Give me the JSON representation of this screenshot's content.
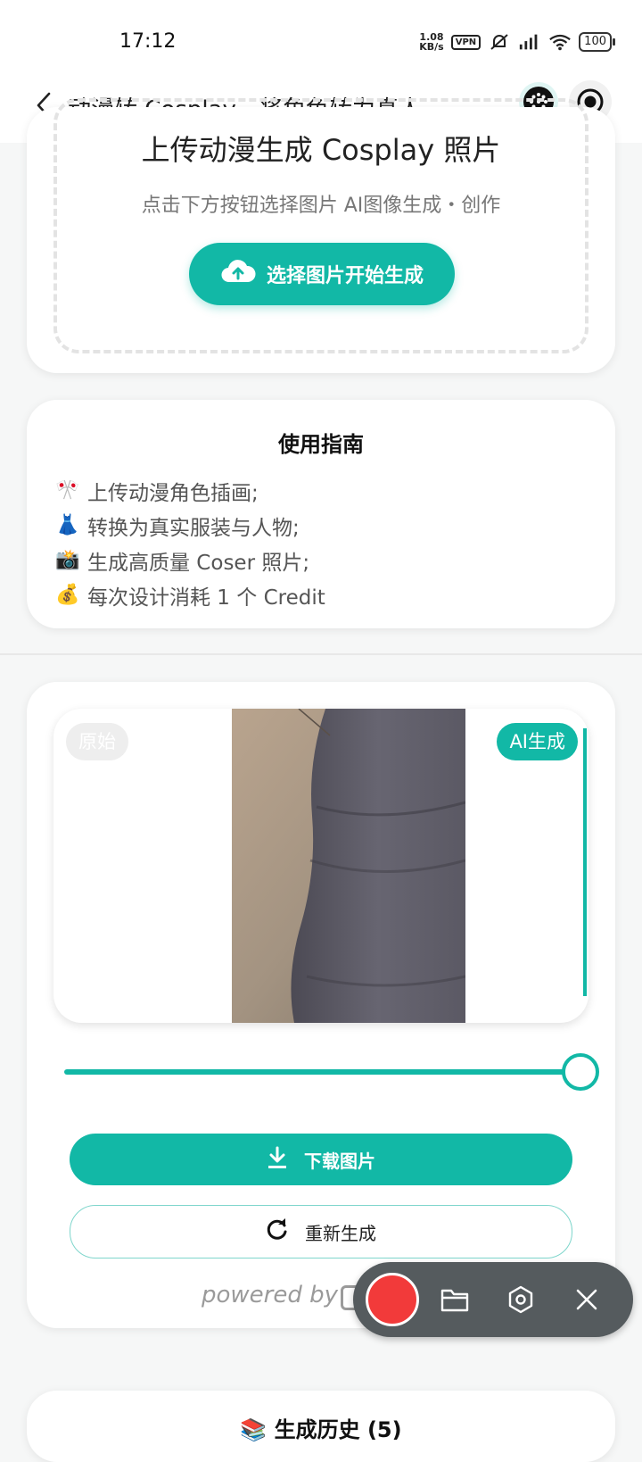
{
  "status_bar": {
    "time": "17:12",
    "net_speed_value": "1.08",
    "net_speed_unit": "KB/s",
    "vpn": "VPN",
    "battery": "100",
    "icons": [
      "vpn-icon",
      "mute-icon",
      "signal-icon",
      "wifi-icon",
      "battery-icon"
    ]
  },
  "nav": {
    "title": "动漫转 Cosplay－将角色转为真人...",
    "back_icon": "chevron-left-icon",
    "menu_icon": "dots-icon",
    "close_icon": "record-target-icon"
  },
  "upload": {
    "title": "上传动漫生成 Cosplay 照片",
    "subtitle": "点击下方按钮选择图片 AI图像生成・创作",
    "button_label": "选择图片开始生成",
    "button_icon": "cloud-upload-icon"
  },
  "guide": {
    "title": "使用指南",
    "items": [
      {
        "emoji": "🎌",
        "text": "上传动漫角色插画;"
      },
      {
        "emoji": "👗",
        "text": "转换为真实服装与人物;"
      },
      {
        "emoji": "📸",
        "text": "生成高质量 Coser 照片;"
      },
      {
        "emoji": "💰",
        "text": "每次设计消耗 1 个 Credit"
      }
    ]
  },
  "result": {
    "badge_original": "原始",
    "badge_ai": "AI生成",
    "slider_value": 1.0,
    "download_label": "下载图片",
    "download_icon": "download-icon",
    "regenerate_label": "重新生成",
    "regenerate_icon": "refresh-icon",
    "powered_by": "powered by",
    "powered_suffix": "NE"
  },
  "history": {
    "title": "📚 生成历史 (5)"
  },
  "recorder": {
    "icons": [
      "record-icon",
      "folder-icon",
      "settings-hex-icon",
      "close-icon"
    ]
  },
  "colors": {
    "accent": "#12b8a6",
    "record_red": "#f23a3a",
    "toolbar_bg": "#555b5e"
  }
}
